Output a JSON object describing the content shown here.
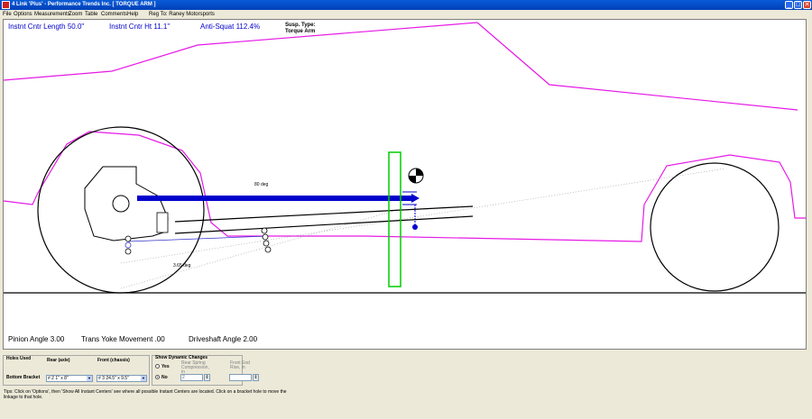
{
  "window": {
    "title": "4 Link 'Plus' - Performance Trends Inc.  [ TORQUE ARM ]",
    "minimize": "_",
    "maximize": "□",
    "close": "✕"
  },
  "menu": [
    "File",
    "Options",
    "Measurements",
    "Zoom",
    "Table",
    "Comments",
    "Help",
    "Reg To: Raney Motorsports"
  ],
  "readouts": {
    "instant_center_length": "Instnt Cntr Length 50.0\"",
    "instant_center_height": "Instnt Cntr Ht  11.1\"",
    "anti_squat": "Anti-Squat  112.4%",
    "susp_type_label": "Susp. Type:",
    "susp_type_value": "Torque Arm"
  },
  "angles": {
    "torque_arm_angle": "80 deg",
    "lower_link_angle": "3.65 deg"
  },
  "bottom_readouts": {
    "pinion_angle": "Pinion Angle  3.00",
    "trans_yoke": "Trans Yoke Movement .00",
    "driveshaft_angle": "Driveshaft Angle 2.00"
  },
  "holes_panel": {
    "title": "Holes Used",
    "rear_header": "Rear (axle)",
    "front_header": "Front (chassis)",
    "row_label": "Bottom Bracket",
    "rear_value": "# 2  1\" x 8\"",
    "front_value": "# 3  24.5\" x 9.5\""
  },
  "dynamic_panel": {
    "title": "Show Dynamic Changes",
    "yes_label": "Yes",
    "no_label": "No",
    "selected": "No",
    "rear_spring_label": "Rear Spring Compression, in",
    "rear_spring_value": "2",
    "front_end_label": "Front End Rise, in",
    "front_end_value": ""
  },
  "tips": "Tips:  Click on 'Options', then 'Show All Instant Centers' see where all possible Instant Centers are located.  Click on a bracket hole to move the linkage to that hole.",
  "colors": {
    "body_outline": "#e619e6",
    "torque_arm": "#0000cc",
    "center_section": "#00cc00",
    "readout_text": "#0000cc",
    "title_bar": "#0a5bd8"
  }
}
